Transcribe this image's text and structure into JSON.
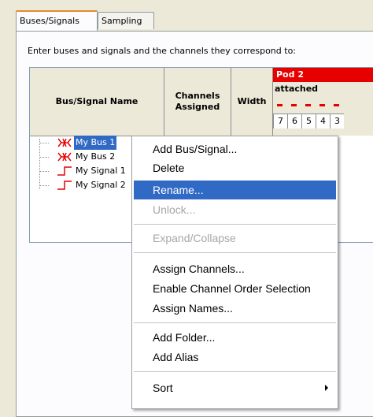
{
  "tabs": [
    {
      "label": "Buses/Signals",
      "active": true
    },
    {
      "label": "Sampling",
      "active": false
    }
  ],
  "instruction": "Enter buses and signals and the channels they correspond to:",
  "grid": {
    "col_name": "Bus/Signal Name",
    "col_channels": "Channels\nAssigned",
    "col_width": "Width",
    "pod_label": "Pod 2",
    "pod_status": "attached",
    "pins": [
      "7",
      "6",
      "5",
      "4",
      "3"
    ],
    "accent_color": "#e60000",
    "rows": [
      {
        "label": "My Bus 1",
        "icon": "bus-icon",
        "selected": true
      },
      {
        "label": "My Bus 2",
        "icon": "bus-icon",
        "selected": false
      },
      {
        "label": "My Signal 1",
        "icon": "signal-icon",
        "selected": false
      },
      {
        "label": "My Signal 2",
        "icon": "signal-icon",
        "selected": false
      }
    ]
  },
  "context_menu": {
    "items": [
      {
        "label": "Add Bus/Signal...",
        "state": "normal"
      },
      {
        "label": "Delete",
        "state": "normal"
      },
      {
        "label": "Rename...",
        "state": "highlighted"
      },
      {
        "label": "Unlock...",
        "state": "disabled"
      },
      {
        "label": "Expand/Collapse",
        "state": "disabled"
      },
      {
        "label": "Assign Channels...",
        "state": "normal"
      },
      {
        "label": "Enable Channel Order Selection",
        "state": "normal"
      },
      {
        "label": "Assign Names...",
        "state": "normal"
      },
      {
        "label": "Add Folder...",
        "state": "normal"
      },
      {
        "label": "Add Alias",
        "state": "normal"
      },
      {
        "label": "Sort",
        "state": "submenu"
      }
    ],
    "highlight_color": "#316ac5"
  }
}
